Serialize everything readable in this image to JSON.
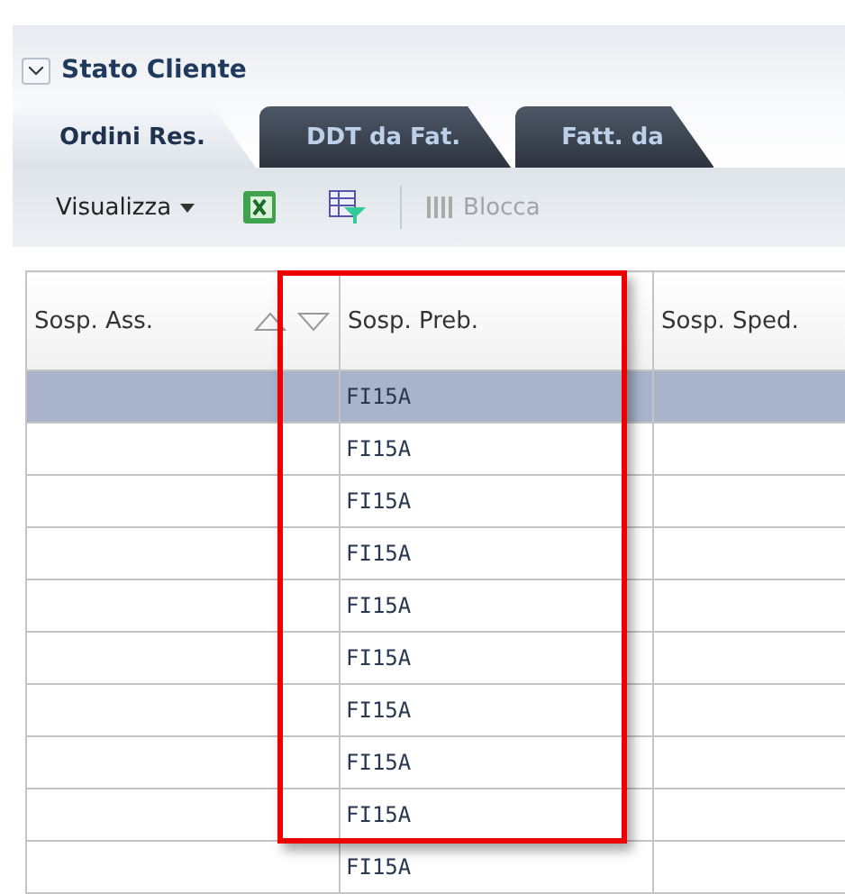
{
  "panel": {
    "title": "Stato Cliente",
    "expanded": true
  },
  "tabs": [
    {
      "label": "Ordini Res.",
      "selected": true
    },
    {
      "label": "DDT da Fat.",
      "selected": false
    },
    {
      "label": "Fatt. da",
      "selected": false
    }
  ],
  "toolbar": [
    {
      "kind": "menu",
      "label": "Visualizza"
    },
    {
      "kind": "excel"
    },
    {
      "kind": "filter"
    },
    {
      "kind": "separator"
    },
    {
      "kind": "freeze",
      "label": "Blocca",
      "disabled": true
    }
  ],
  "table": {
    "columns": [
      {
        "label": "Sosp. Ass.",
        "sortable": true
      },
      {
        "label": "Sosp. Preb."
      },
      {
        "label": "Sosp. Sped."
      }
    ],
    "rows": [
      {
        "cells": [
          "",
          "FI15A",
          ""
        ],
        "selected": true
      },
      {
        "cells": [
          "",
          "FI15A",
          ""
        ],
        "selected": false
      },
      {
        "cells": [
          "",
          "FI15A",
          ""
        ],
        "selected": false
      },
      {
        "cells": [
          "",
          "FI15A",
          ""
        ],
        "selected": false
      },
      {
        "cells": [
          "",
          "FI15A",
          ""
        ],
        "selected": false
      },
      {
        "cells": [
          "",
          "FI15A",
          ""
        ],
        "selected": false
      },
      {
        "cells": [
          "",
          "FI15A",
          ""
        ],
        "selected": false
      },
      {
        "cells": [
          "",
          "FI15A",
          ""
        ],
        "selected": false
      },
      {
        "cells": [
          "",
          "FI15A",
          ""
        ],
        "selected": false
      },
      {
        "cells": [
          "",
          "FI15A",
          ""
        ],
        "selected": false
      }
    ]
  },
  "highlight": {
    "shown": true
  }
}
